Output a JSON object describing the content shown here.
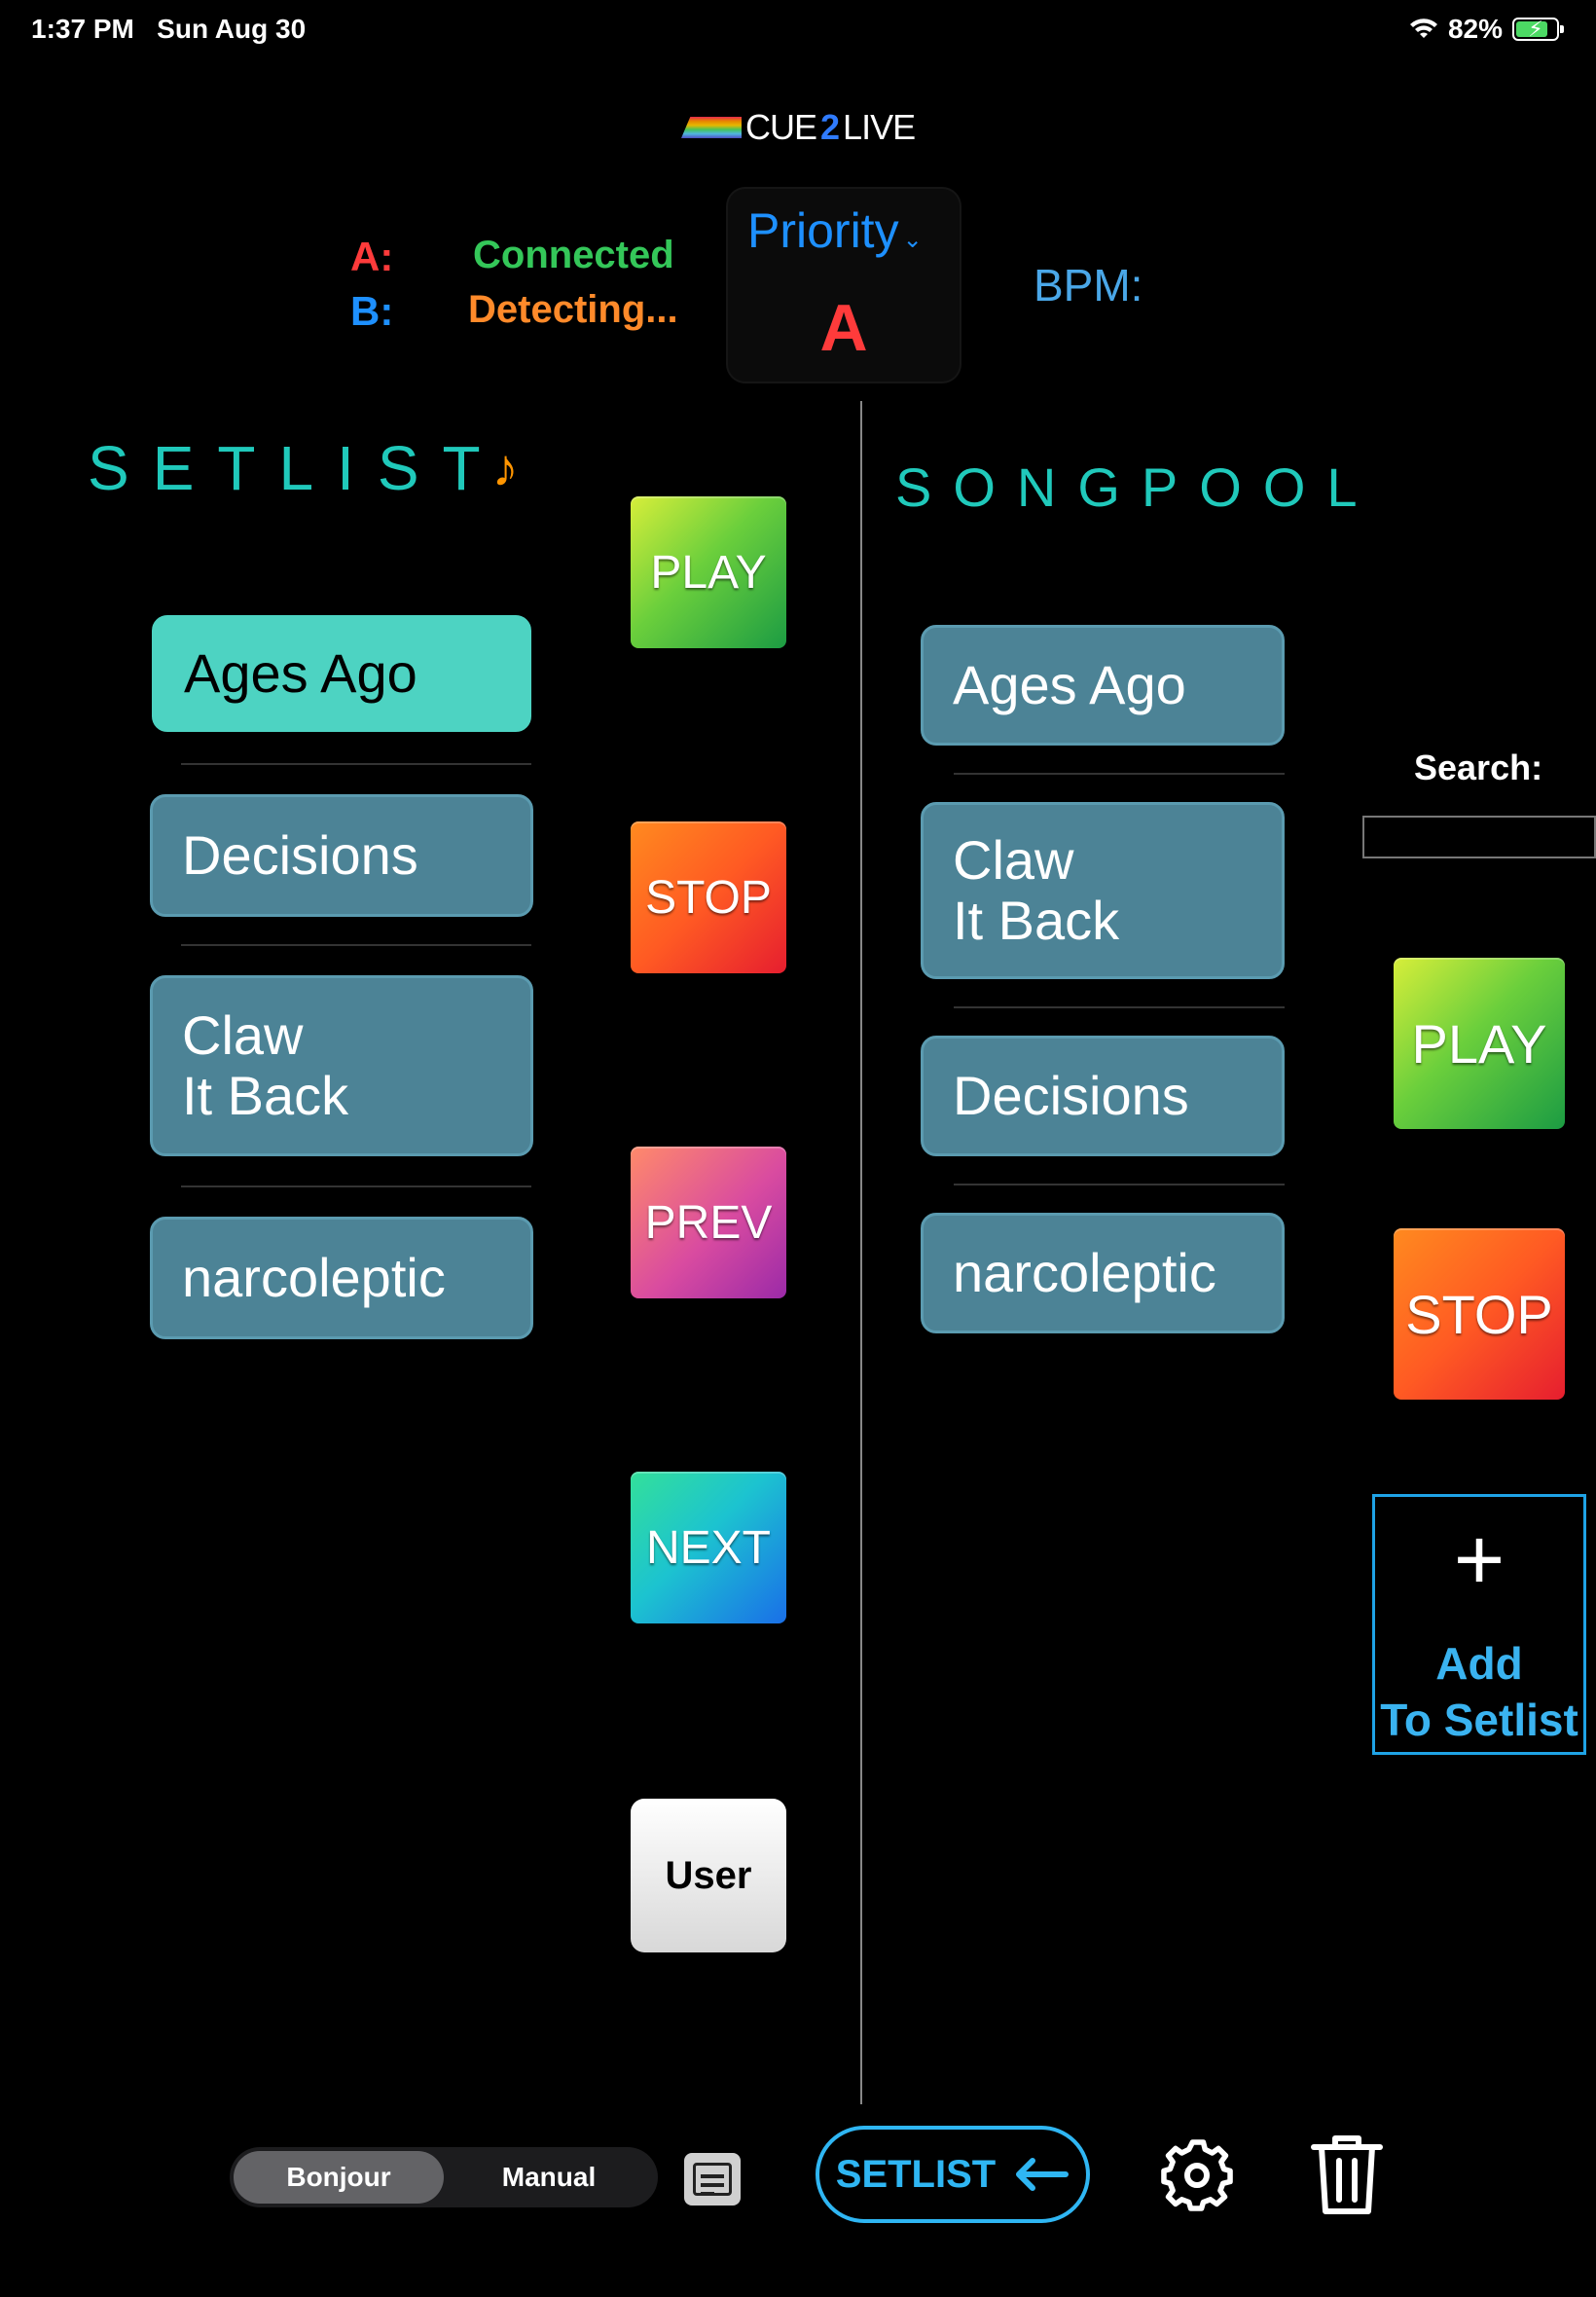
{
  "status_bar": {
    "time": "1:37 PM",
    "date": "Sun Aug 30",
    "battery": "82%",
    "battery_level": 0.82,
    "wifi_icon": "wifi-icon",
    "battery_icon": "battery-charging-icon"
  },
  "header": {
    "logo_prefix": "CUE",
    "logo_two": "2",
    "logo_suffix": "LIVE",
    "channel_a_label": "A:",
    "channel_b_label": "B:",
    "channel_a_status": "Connected",
    "channel_b_status": "Detecting...",
    "priority_label": "Priority",
    "priority_value": "A",
    "bpm_label": "BPM:"
  },
  "setlist": {
    "title": "SETLIST",
    "title_icon": "music-note-icon",
    "songs": [
      "Ages Ago",
      "Decisions",
      "Claw\nIt Back",
      "narcoleptic"
    ]
  },
  "songpool": {
    "title": "SONGPOOL",
    "songs": [
      "Ages Ago",
      "Claw\nIt Back",
      "Decisions",
      "narcoleptic"
    ]
  },
  "controls": {
    "play": "PLAY",
    "stop": "STOP",
    "prev": "PREV",
    "next": "NEXT",
    "user": "User"
  },
  "pool_controls": {
    "play": "PLAY",
    "stop": "STOP"
  },
  "search": {
    "label": "Search:",
    "value": "",
    "placeholder": ""
  },
  "add_to_setlist": {
    "plus": "+",
    "label": "Add\nTo Setlist"
  },
  "bottom_bar": {
    "mode_options": [
      "Bonjour",
      "Manual"
    ],
    "mode_selected": "Bonjour",
    "setlist_button": "SETLIST",
    "setlist_arrow_icon": "arrow-left-icon",
    "doc_icon": "document-icon",
    "settings_icon": "gear-icon",
    "delete_icon": "trash-icon"
  },
  "colors": {
    "accent_teal": "#20c9bb",
    "song_tile": "#4c8396",
    "song_active": "#4dd3c2",
    "priority_a": "#ff3b3b",
    "connected": "#34c759",
    "detecting": "#ff8a2a",
    "link_blue": "#2fb6f3"
  }
}
